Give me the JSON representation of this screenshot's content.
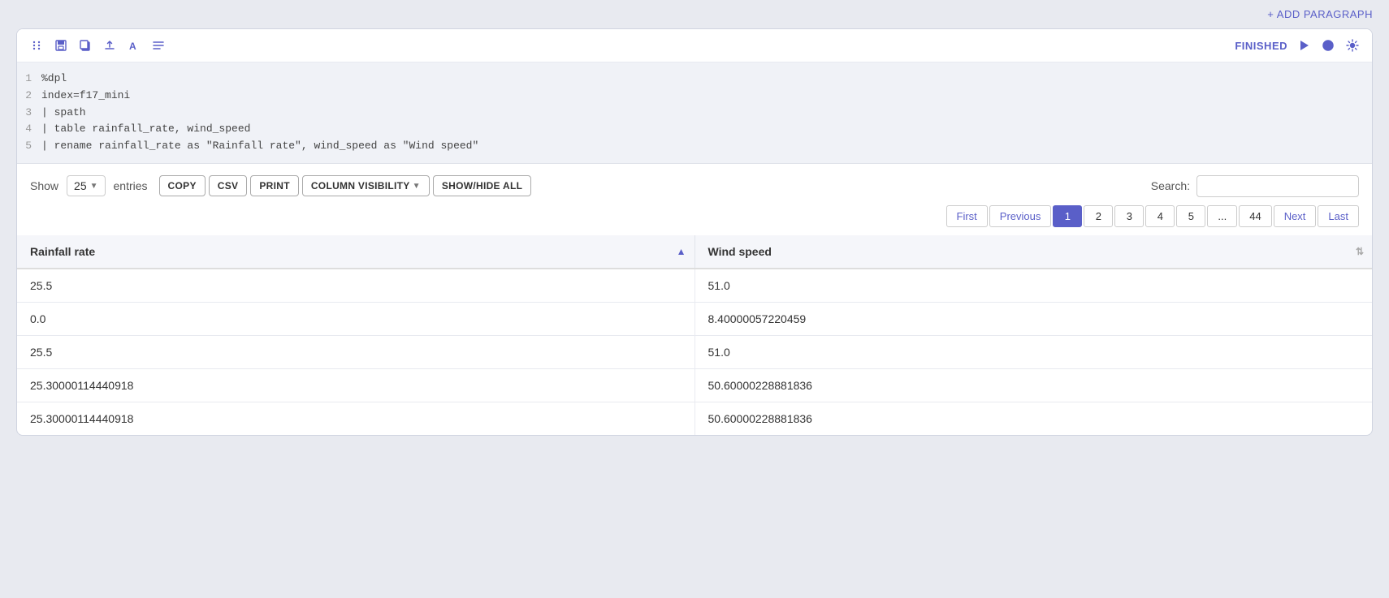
{
  "topbar": {
    "add_paragraph_label": "+ ADD PARAGRAPH"
  },
  "cell": {
    "toolbar": {
      "icons": [
        "move",
        "save",
        "copy",
        "upload",
        "text",
        "list"
      ],
      "status": "FINISHED"
    },
    "code": [
      {
        "line": 1,
        "content": "%dpl"
      },
      {
        "line": 2,
        "content": "index=f17_mini"
      },
      {
        "line": 3,
        "content": "| spath"
      },
      {
        "line": 4,
        "content": "| table rainfall_rate, wind_speed"
      },
      {
        "line": 5,
        "content": "| rename rainfall_rate as \"Rainfall rate\", wind_speed as \"Wind speed\""
      }
    ]
  },
  "table_controls": {
    "show_label": "Show",
    "entries_value": "25",
    "entries_label": "entries",
    "buttons": [
      "COPY",
      "CSV",
      "PRINT"
    ],
    "column_visibility_label": "COLUMN VISIBILITY",
    "show_hide_all_label": "SHOW/HIDE ALL",
    "search_label": "Search:"
  },
  "pagination": {
    "first_label": "First",
    "previous_label": "Previous",
    "pages": [
      "1",
      "2",
      "3",
      "4",
      "5",
      "...",
      "44"
    ],
    "next_label": "Next",
    "last_label": "Last"
  },
  "table": {
    "columns": [
      {
        "label": "Rainfall rate"
      },
      {
        "label": "Wind speed"
      }
    ],
    "rows": [
      {
        "rainfall": "25.5",
        "wind": "51.0"
      },
      {
        "rainfall": "0.0",
        "wind": "8.40000057220459"
      },
      {
        "rainfall": "25.5",
        "wind": "51.0"
      },
      {
        "rainfall": "25.30000114440918",
        "wind": "50.60000228881836"
      },
      {
        "rainfall": "25.30000114440918",
        "wind": "50.60000228881836"
      }
    ]
  }
}
